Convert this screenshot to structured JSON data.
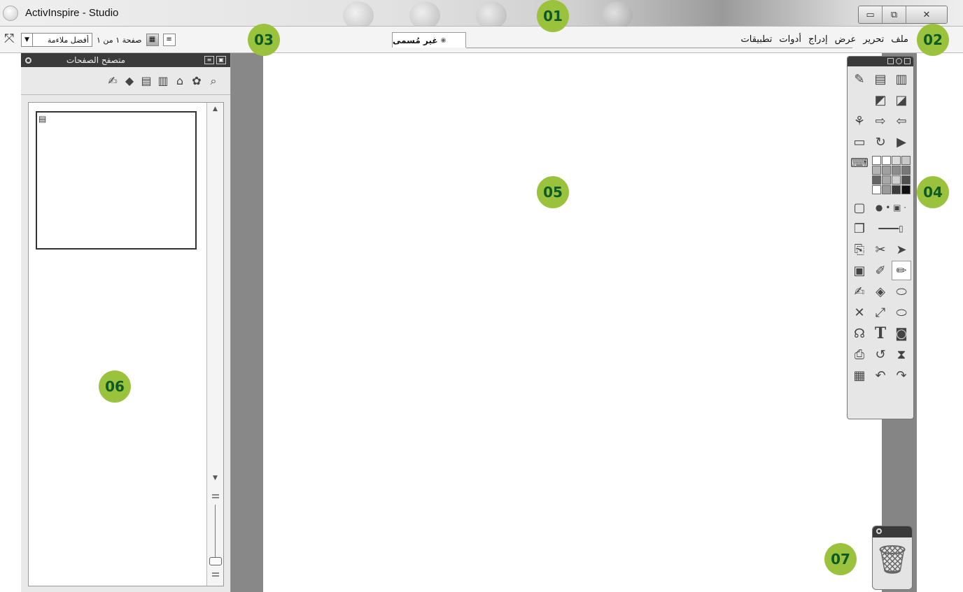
{
  "window": {
    "title": "ActivInspire - Studio",
    "controls": [
      "minimize-icon",
      "maximize-icon",
      "close-icon"
    ]
  },
  "menu": {
    "items": [
      "ملف",
      "تحرير",
      "عرض",
      "إدراج",
      "أدوات",
      "تطبيقات"
    ]
  },
  "page_nav": {
    "zoom_value": "أفضل ملاءمة",
    "page_text": "صفحة ١ من ١"
  },
  "document_tab": {
    "label": "غير مُسمى"
  },
  "page_browser": {
    "title": "متصفح الصفحات",
    "tools": [
      "page-notes-icon",
      "pens-icon",
      "notes-icon",
      "list-icon",
      "object-browser-icon",
      "resources-icon",
      "properties-icon"
    ],
    "page_count": 1
  },
  "toolbox": {
    "palette": [
      "#ffffff",
      "#ffffff",
      "#dcdcdc",
      "#c8c8c8",
      "#b4b4b4",
      "#a0a0a0",
      "#8c8c8c",
      "#787878",
      "#646464",
      "#a8a8a8",
      "#d0d0d0",
      "#505050",
      "#ffffff",
      "#9a9a9a",
      "#3c3c3c",
      "#111111"
    ]
  },
  "callouts": [
    "01",
    "02",
    "03",
    "04",
    "05",
    "06",
    "07"
  ]
}
